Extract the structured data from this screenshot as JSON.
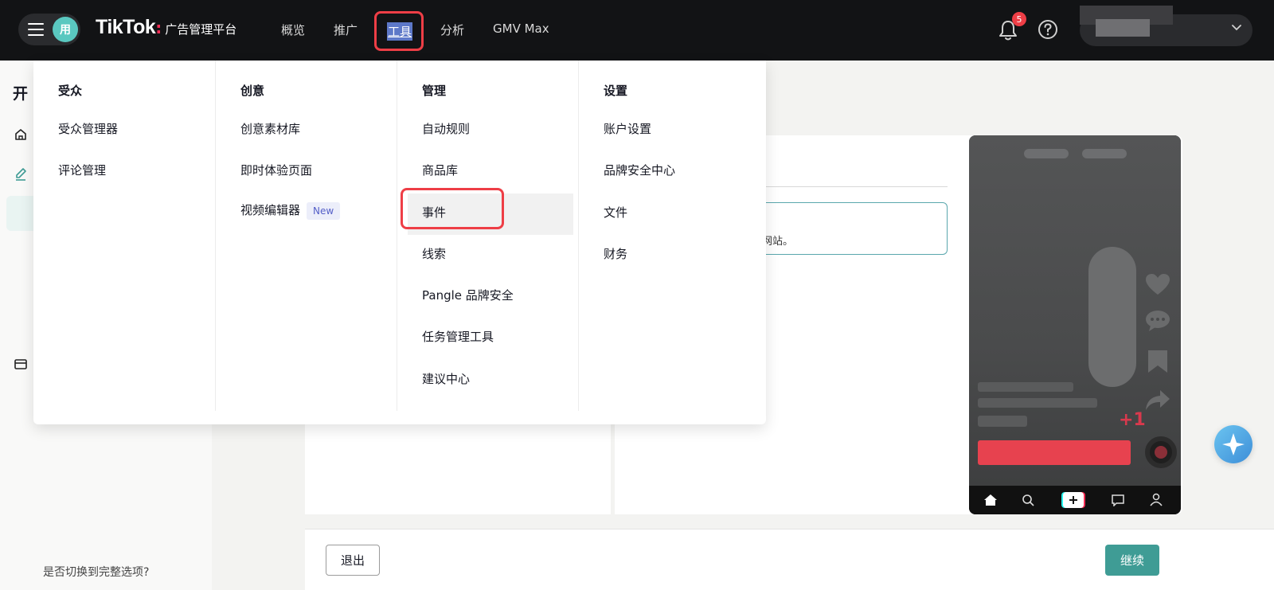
{
  "topnav": {
    "avatar_initial": "用",
    "logo_brand": "TikTok",
    "logo_colon": ":",
    "logo_sub": "广告管理平台",
    "items": [
      {
        "label": "概览"
      },
      {
        "label": "推广"
      },
      {
        "label": "工具",
        "active": true
      },
      {
        "label": "分析"
      },
      {
        "label": "GMV Max"
      }
    ],
    "notification_count": "5",
    "icons": [
      "menu-icon",
      "bell-icon",
      "help-icon",
      "chevron-down-icon"
    ]
  },
  "sidebar": {
    "title_partial": "开",
    "switch_link": "是否切换到完整选项?"
  },
  "dropdown": {
    "columns": [
      {
        "heading": "受众",
        "items": [
          {
            "label": "受众管理器"
          },
          {
            "label": "评论管理"
          }
        ]
      },
      {
        "heading": "创意",
        "items": [
          {
            "label": "创意素材库"
          },
          {
            "label": "即时体验页面"
          },
          {
            "label": "视频编辑器",
            "tag": "New"
          }
        ]
      },
      {
        "heading": "管理",
        "items": [
          {
            "label": "自动规则"
          },
          {
            "label": "商品库"
          },
          {
            "label": "事件",
            "highlighted": true
          },
          {
            "label": "线索"
          },
          {
            "label": "Pangle 品牌安全"
          },
          {
            "label": "任务管理工具"
          },
          {
            "label": "建议中心"
          }
        ]
      },
      {
        "heading": "设置",
        "items": [
          {
            "label": "账户设置"
          },
          {
            "label": "品牌安全中心"
          },
          {
            "label": "文件"
          },
          {
            "label": "财务"
          }
        ]
      }
    ]
  },
  "main": {
    "notice_text_partial": "网站。",
    "phone_preview": {
      "plus_one": "+1"
    },
    "buttons": {
      "exit": "退出",
      "continue": "继续"
    }
  },
  "colors": {
    "topbar": "#121315",
    "accent_teal": "#3f9c95",
    "highlight_red": "#ee3e46",
    "tiktok_pink": "#fe2c55"
  }
}
